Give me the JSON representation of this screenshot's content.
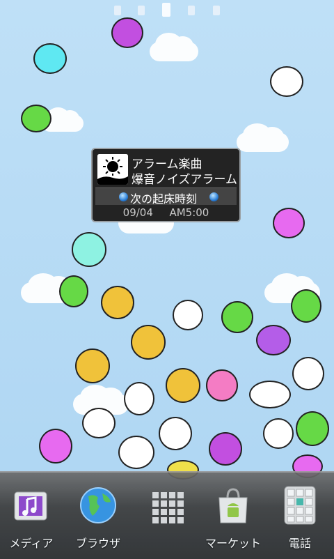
{
  "widget": {
    "app_name": "アラーム楽曲",
    "alarm_name": "爆音ノイズアラーム",
    "next_label": "次の起床時刻",
    "date": "09/04",
    "time": "AM5:00"
  },
  "dock": [
    {
      "label": "メディア",
      "icon": "media-icon"
    },
    {
      "label": "ブラウザ",
      "icon": "globe-icon"
    },
    {
      "label": "",
      "icon": "app-grid-icon"
    },
    {
      "label": "マーケット",
      "icon": "market-icon"
    },
    {
      "label": "電話",
      "icon": "phone-dialpad-icon"
    }
  ],
  "home_pages": {
    "count": 5,
    "current": 3
  },
  "colors": {
    "sky": "#b9dcf4",
    "dock": "#3b3b3b",
    "widget_bg": "#232323",
    "accent_blue": "#2b7fd8"
  }
}
